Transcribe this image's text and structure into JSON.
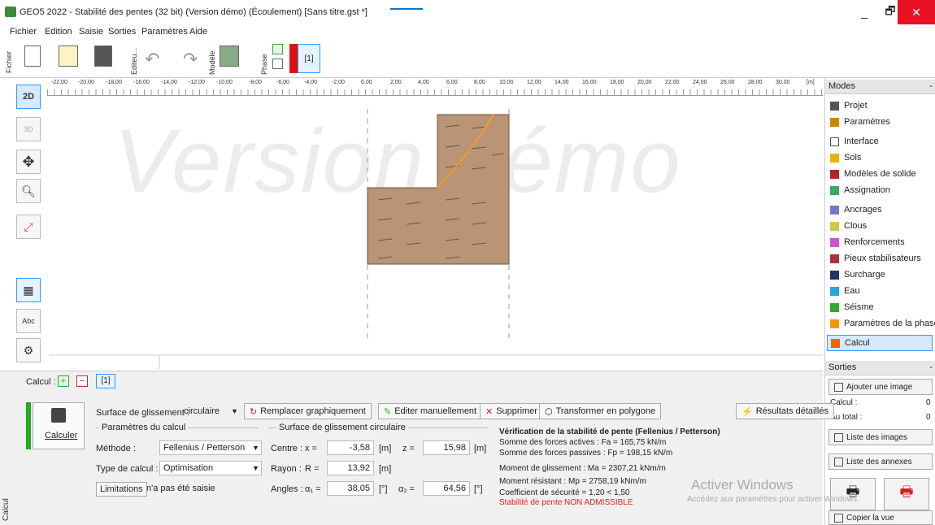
{
  "window": {
    "title": "GEO5 2022 - Stabilité des pentes (32 bit) (Version démo) (Écoulement) [Sans titre.gst *]",
    "minimize": "_",
    "maximize": "🗗",
    "close": "✕"
  },
  "menu": [
    "Fichier",
    "Edition",
    "Saisie",
    "Sorties",
    "Paramètres",
    "Aide"
  ],
  "toolbar": {
    "fichier_label": "Fichier",
    "editeur_label": "Editeu...",
    "modele_label": "Modèle",
    "phase_label": "Phase",
    "phase_num": "[1]"
  },
  "ruler": {
    "ticks": [
      "-22,00",
      "-20,00",
      "-18,00",
      "-16,00",
      "-14,00",
      "-12,00",
      "-10,00",
      "-8,00",
      "-6,00",
      "-4,00",
      "-2,00",
      "0,00",
      "2,00",
      "4,00",
      "6,00",
      "8,00",
      "10,00",
      "12,00",
      "14,00",
      "16,00",
      "18,00",
      "20,00",
      "22,00",
      "24,00",
      "26,00",
      "28,00",
      "30,00",
      "[m]"
    ]
  },
  "left_tools": {
    "tool_2d": "2D",
    "tool_3d": "3D"
  },
  "watermark": "Version démo",
  "modes": {
    "header": "Modes",
    "collapse": "-",
    "items": [
      "Projet",
      "Paramètres",
      "Interface",
      "Sols",
      "Modèles de solide",
      "Assignation",
      "Ancrages",
      "Clous",
      "Renforcements",
      "Pieux stabilisateurs",
      "Surcharge",
      "Eau",
      "Séisme",
      "Paramètres de la phase",
      "Calcul"
    ]
  },
  "sorties": {
    "header": "Sorties",
    "collapse": "-",
    "add_image": "Ajouter une image",
    "calcul_label": "Calcul :",
    "calcul_val": "0",
    "total_label": "Au total :",
    "total_val": "0",
    "list_images": "Liste des images",
    "list_annexes": "Liste des annexes",
    "copy_view": "Copier la vue"
  },
  "calc_panel": {
    "calcul_label": "Calcul :",
    "tab": "[1]",
    "calculer": "Calculer",
    "side_label": "Calcul",
    "surface_label": "Surface de glissement :",
    "surface_value": "circulaire",
    "btn_replace": "Remplacer graphiquement",
    "btn_edit": "Editer manuellement",
    "btn_delete": "Supprimer",
    "btn_transform": "Transformer en polygone",
    "btn_results": "Résultats détaillés",
    "params_group": "Paramètres du calcul",
    "methode_label": "Méthode :",
    "methode_value": "Fellenius / Petterson",
    "type_label": "Type de calcul :",
    "type_value": "Optimisation",
    "limitations_btn": "Limitations",
    "limitations_text": "n'a pas été saisie",
    "circ_group": "Surface de glissement circulaire",
    "centre_label": "Centre :",
    "x_label": "x =",
    "x_value": "-3,58",
    "x_unit": "[m]",
    "z_label": "z =",
    "z_value": "15,98",
    "z_unit": "[m]",
    "rayon_label": "Rayon :",
    "r_label": "R =",
    "r_value": "13,92",
    "r_unit": "[m]",
    "angles_label": "Angles :",
    "a1_label": "α₁ =",
    "a1_value": "38,05",
    "a1_unit": "[°]",
    "a2_label": "α₂ =",
    "a2_value": "64,56",
    "a2_unit": "[°]"
  },
  "results": {
    "title": "Vérification de la stabilité de pente (Fellenius / Petterson)",
    "line1": "Somme des forces actives :    Fa =  165,75  kN/m",
    "line2": "Somme des forces passives :  Fp =  198,15  kN/m",
    "line3": "Moment de glissement :          Ma = 2307,21  kNm/m",
    "line4": "Moment résistant :                Mp = 2758,19  kNm/m",
    "line5": "Coefficient de sécurité = 1,20 < 1,50",
    "line6": "Stabilité de pente NON ADMISSIBLE"
  },
  "activate": {
    "line1": "Activer Windows",
    "line2": "Accédez aux paramètres pour activer Windows."
  },
  "colors": {
    "soil": "#b99475",
    "slip": "#f39a2a",
    "fail": "#e0231b",
    "accent": "#0078d7"
  }
}
